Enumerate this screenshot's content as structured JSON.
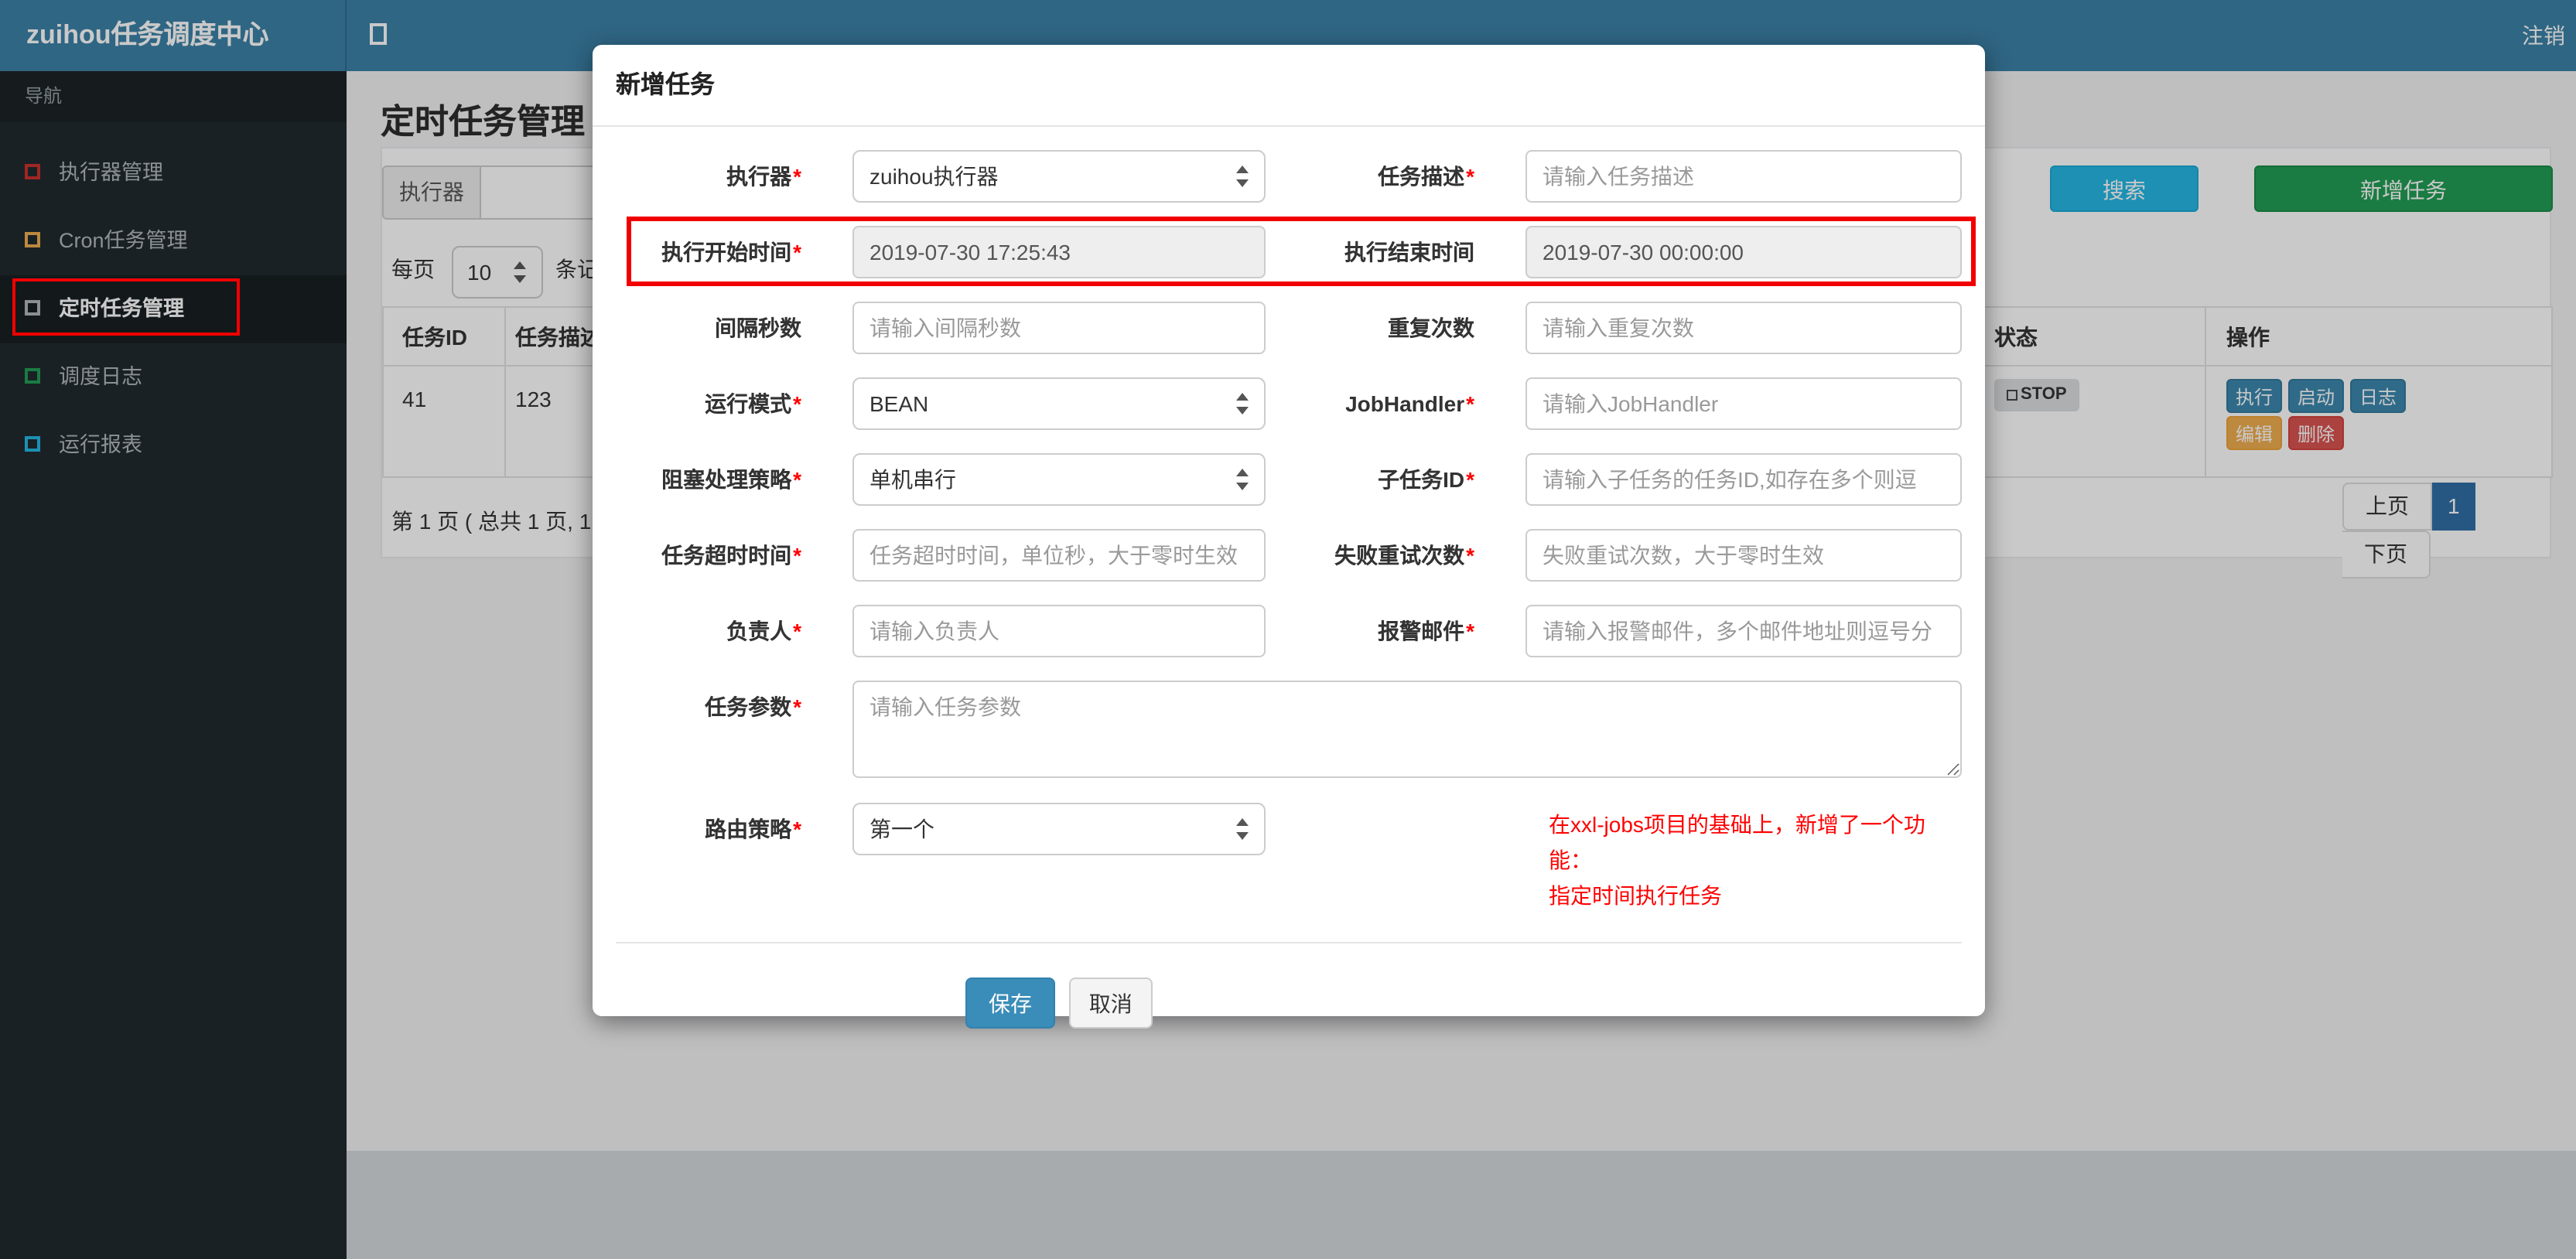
{
  "navbar": {
    "brand": "zuihou任务调度中心",
    "logout": "注销"
  },
  "sidebar": {
    "nav_header": "导航",
    "items": [
      {
        "label": "执行器管理",
        "icon_color": "#c9302c"
      },
      {
        "label": "Cron任务管理",
        "icon_color": "#f0ad4e"
      },
      {
        "label": "定时任务管理",
        "icon_color": "#b0b5ba",
        "active": true
      },
      {
        "label": "调度日志",
        "icon_color": "#1f9d52"
      },
      {
        "label": "运行报表",
        "icon_color": "#23b7e5"
      }
    ]
  },
  "page": {
    "heading": "定时任务管理",
    "filter": {
      "executor_label": "执行器"
    },
    "toolbar": {
      "search": "搜索",
      "add_task": "新增任务"
    },
    "per_page": {
      "prefix": "每页",
      "value": "10",
      "suffix": "条记"
    },
    "table": {
      "col_id": "任务ID",
      "col_desc": "任务描述",
      "col_status": "状态",
      "col_ops": "操作",
      "row": {
        "id": "41",
        "desc": "123",
        "status": "STOP",
        "ops": {
          "run": "执行",
          "start": "启动",
          "log": "日志",
          "edit": "编辑",
          "del": "删除"
        }
      }
    },
    "pagination": {
      "info": "第 1 页 ( 总共 1 页, 1",
      "prev": "上页",
      "current": "1",
      "next": "下页"
    }
  },
  "modal": {
    "title": "新增任务",
    "required_mark": "*",
    "fields": {
      "executor": {
        "label": "执行器",
        "value": "zuihou执行器"
      },
      "desc": {
        "label": "任务描述",
        "placeholder": "请输入任务描述"
      },
      "start": {
        "label": "执行开始时间",
        "value": "2019-07-30 17:25:43"
      },
      "end": {
        "label": "执行结束时间",
        "value": "2019-07-30 00:00:00"
      },
      "interval": {
        "label": "间隔秒数",
        "placeholder": "请输入间隔秒数"
      },
      "repeat": {
        "label": "重复次数",
        "placeholder": "请输入重复次数"
      },
      "mode": {
        "label": "运行模式",
        "value": "BEAN"
      },
      "handler": {
        "label": "JobHandler",
        "placeholder": "请输入JobHandler"
      },
      "block": {
        "label": "阻塞处理策略",
        "value": "单机串行"
      },
      "child": {
        "label": "子任务ID",
        "placeholder": "请输入子任务的任务ID,如存在多个则逗"
      },
      "timeout": {
        "label": "任务超时时间",
        "placeholder": "任务超时时间，单位秒，大于零时生效"
      },
      "retry": {
        "label": "失败重试次数",
        "placeholder": "失败重试次数，大于零时生效"
      },
      "owner": {
        "label": "负责人",
        "placeholder": "请输入负责人"
      },
      "email": {
        "label": "报警邮件",
        "placeholder": "请输入报警邮件，多个邮件地址则逗号分"
      },
      "params": {
        "label": "任务参数",
        "placeholder": "请输入任务参数"
      },
      "route": {
        "label": "路由策略",
        "value": "第一个"
      }
    },
    "note_line1": "在xxl-jobs项目的基础上，新增了一个功能：",
    "note_line2": "指定时间执行任务",
    "save": "保存",
    "cancel": "取消"
  },
  "colors": {
    "navbar_bg": "#3a81a7",
    "sidebar_bg": "#1f282d",
    "search_btn": "#23b7e5",
    "add_btn": "#1f9d52",
    "save_btn": "#3a8db8",
    "op_blue": "#3a87ad",
    "op_orange": "#f0ad4e",
    "op_red": "#d9534f",
    "pagination_active": "#2e6da4",
    "annotation_red": "#f20000",
    "note_red": "#ff0000",
    "status_badge_bg": "#dbdee0"
  }
}
